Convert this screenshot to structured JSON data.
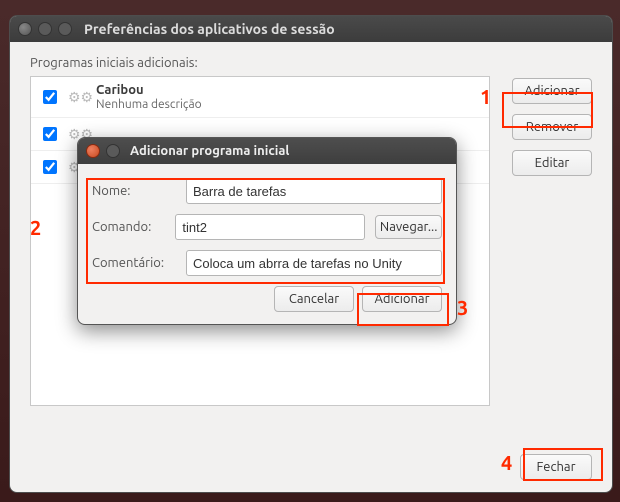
{
  "window": {
    "title": "Preferências dos aplicativos de sessão"
  },
  "section_label": "Programas iniciais adicionais:",
  "startup_items": [
    {
      "title": "Caribou",
      "descr": "Nenhuma descrição",
      "checked": true
    }
  ],
  "buttons": {
    "add": "Adicionar",
    "remove": "Remover",
    "edit": "Editar",
    "close": "Fechar"
  },
  "dialog": {
    "title": "Adicionar programa inicial",
    "labels": {
      "name": "Nome:",
      "command": "Comando:",
      "comment": "Comentário:"
    },
    "values": {
      "name": "Barra de tarefas",
      "command": "tint2",
      "comment": "Coloca um abrra de tarefas no Unity"
    },
    "buttons": {
      "browse": "Navegar...",
      "cancel": "Cancelar",
      "add": "Adicionar"
    }
  },
  "annotations": {
    "n1": "1",
    "n2": "2",
    "n3": "3",
    "n4": "4"
  }
}
